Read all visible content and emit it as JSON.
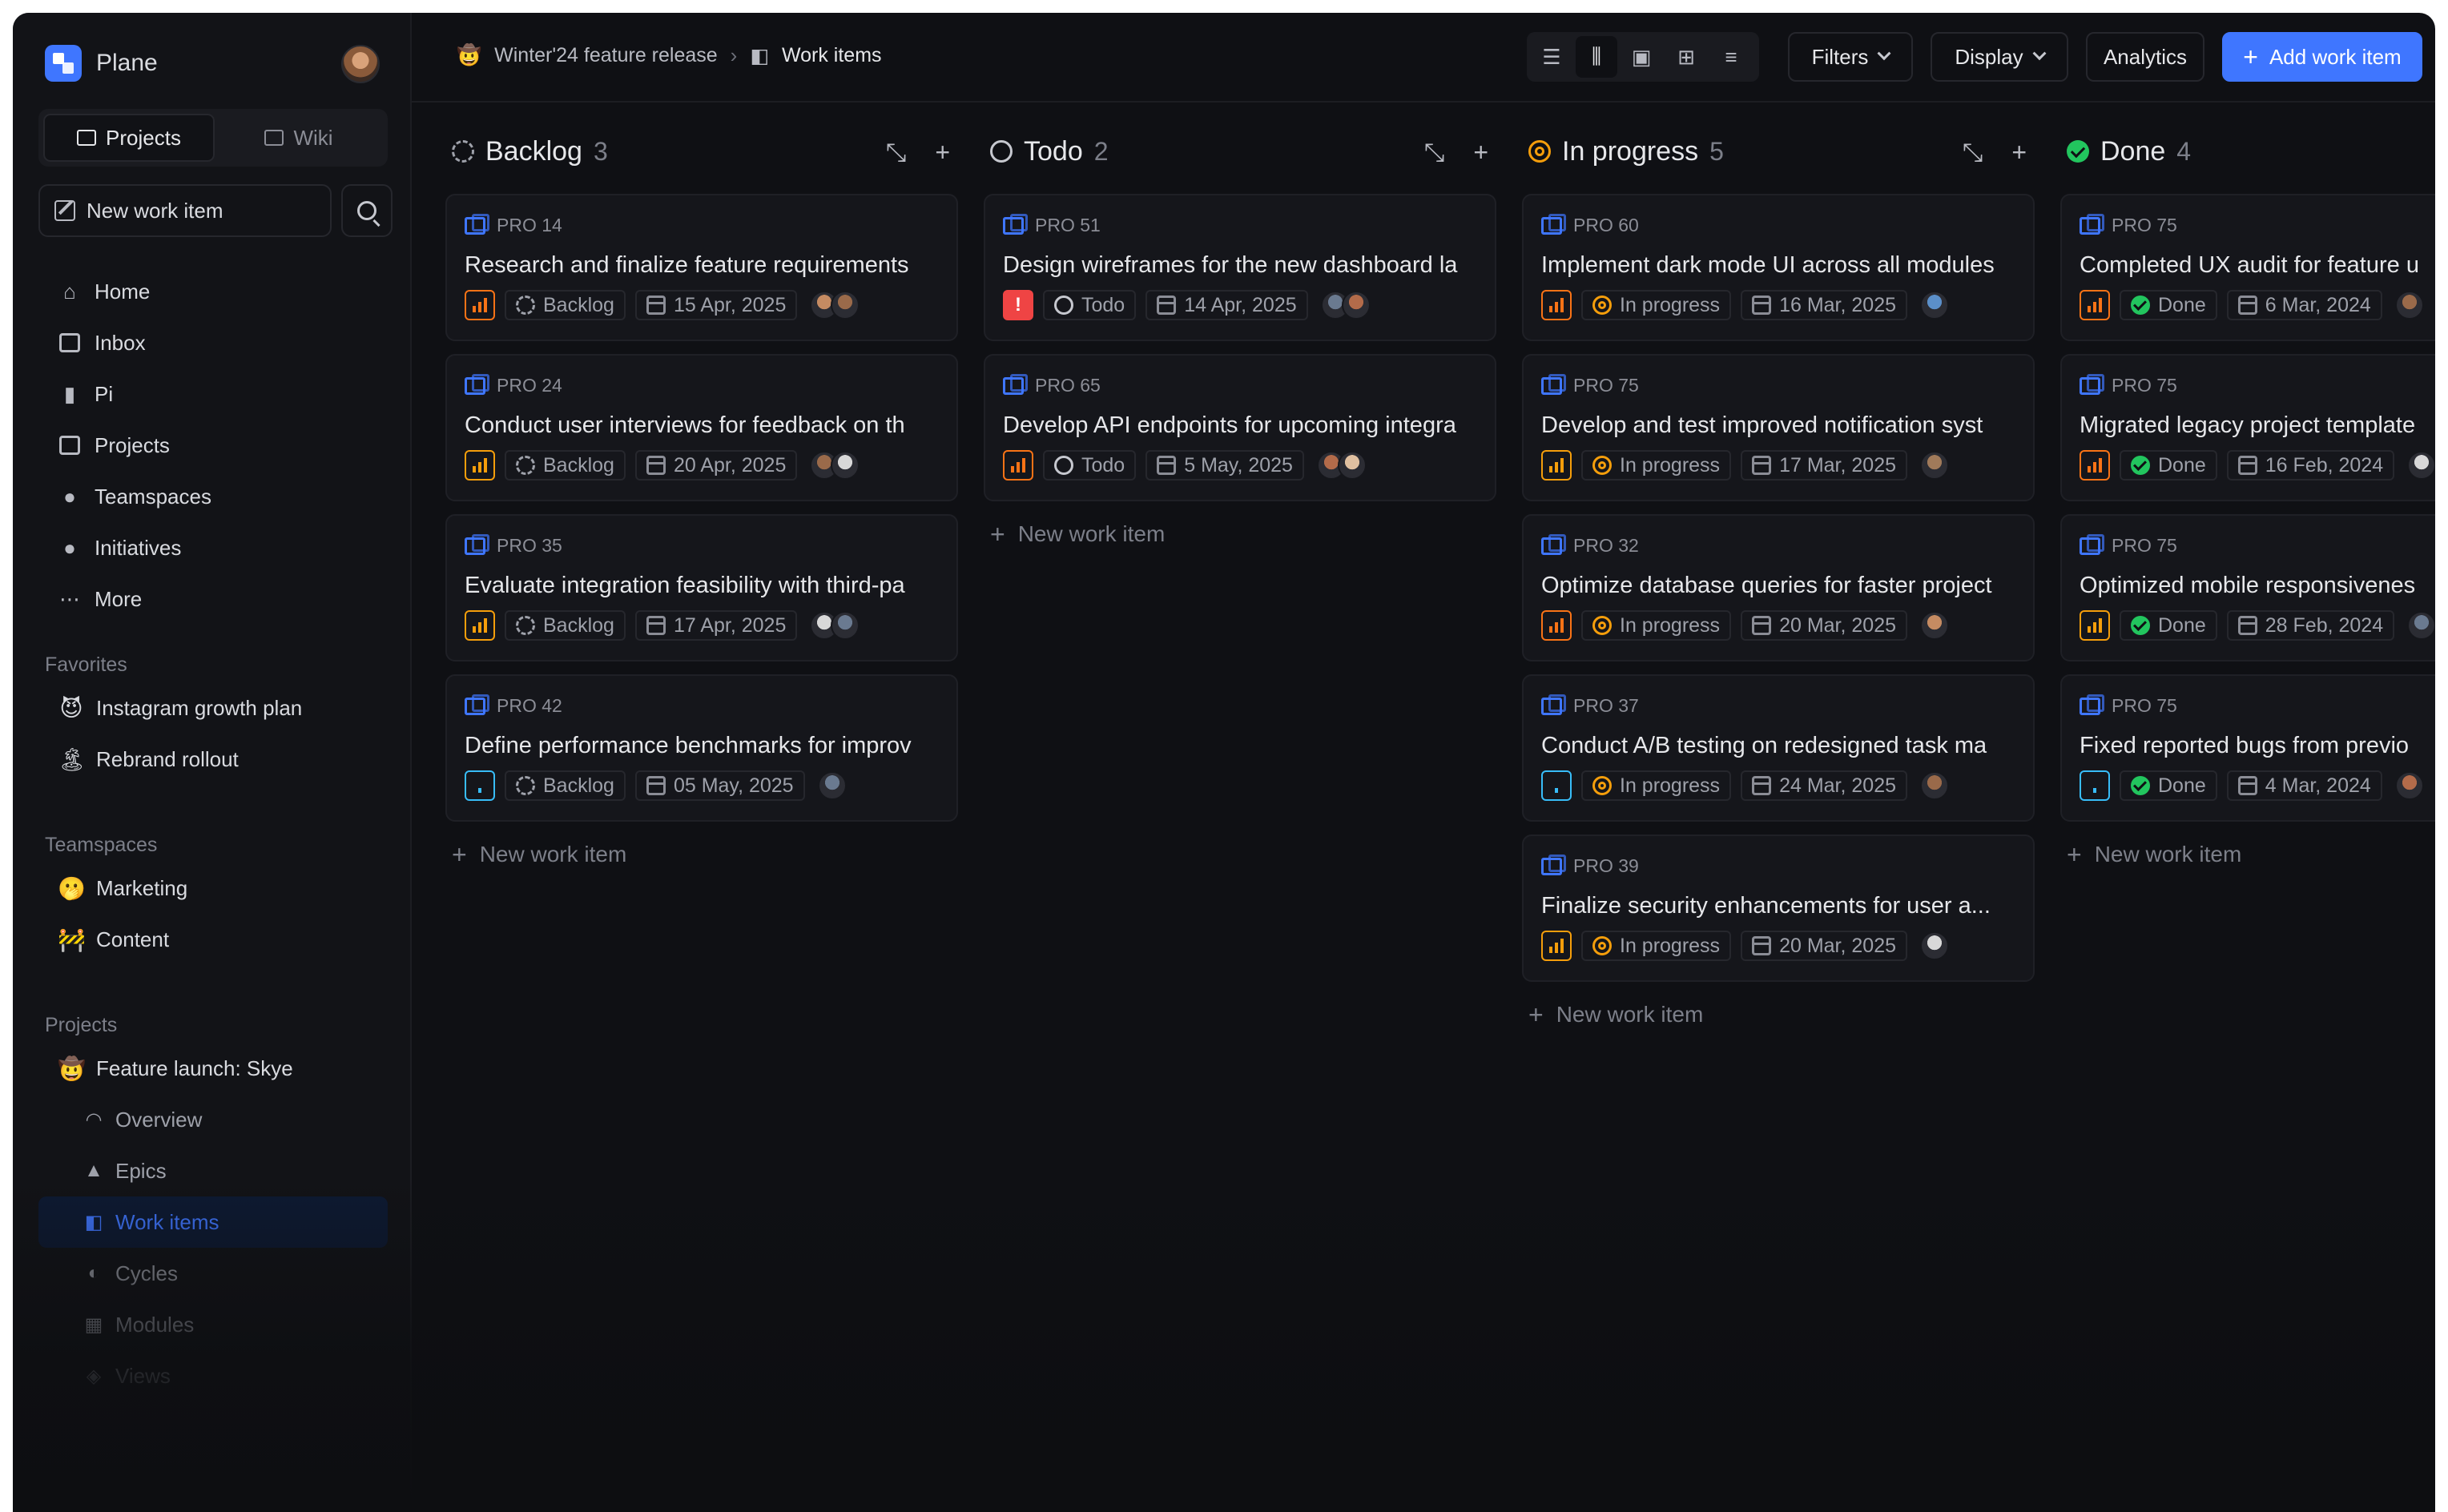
{
  "app": {
    "name": "Plane"
  },
  "sidebar": {
    "tabs": [
      {
        "label": "Projects"
      },
      {
        "label": "Wiki"
      }
    ],
    "new_work_item": "New work item",
    "nav": [
      {
        "label": "Home",
        "icon": "home-icon"
      },
      {
        "label": "Inbox",
        "icon": "inbox-icon"
      },
      {
        "label": "Pi",
        "icon": "pi-icon"
      },
      {
        "label": "Projects",
        "icon": "briefcase-icon"
      },
      {
        "label": "Teamspaces",
        "icon": "team-icon"
      },
      {
        "label": "Initiatives",
        "icon": "initiative-icon"
      },
      {
        "label": "More",
        "icon": "more-icon"
      }
    ],
    "favorites": {
      "heading": "Favorites",
      "items": [
        {
          "label": "Instagram growth plan",
          "emoji": "😈"
        },
        {
          "label": "Rebrand rollout",
          "emoji": "🏝"
        }
      ]
    },
    "teamspaces": {
      "heading": "Teamspaces",
      "items": [
        {
          "label": "Marketing",
          "emoji": "🫢"
        },
        {
          "label": "Content",
          "emoji": "🚧"
        }
      ]
    },
    "projects": {
      "heading": "Projects",
      "project": {
        "label": "Feature launch: Skye",
        "emoji": "🤠"
      },
      "subitems": [
        {
          "label": "Overview",
          "icon": "rss-icon"
        },
        {
          "label": "Epics",
          "icon": "epics-icon"
        },
        {
          "label": "Work items",
          "icon": "work-items-icon"
        },
        {
          "label": "Cycles",
          "icon": "cycles-icon"
        },
        {
          "label": "Modules",
          "icon": "modules-icon"
        },
        {
          "label": "Views",
          "icon": "views-icon"
        }
      ]
    }
  },
  "topbar": {
    "breadcrumb": [
      {
        "label": "Winter'24 feature release",
        "emoji": "🤠"
      },
      {
        "label": "Work items"
      }
    ],
    "filters": "Filters",
    "display": "Display",
    "analytics": "Analytics",
    "add": "Add work item"
  },
  "colors": {
    "accent": "#3f76ff",
    "urgent": "#ef4444",
    "high": "#f97316",
    "medium": "#f59e0b",
    "low": "#38bdf8",
    "done": "#22c55e"
  },
  "board": {
    "new_item": "New work item",
    "columns": [
      {
        "title": "Backlog",
        "count": "3",
        "status": "backlog",
        "cards": [
          {
            "id": "PRO 14",
            "title": "Research and finalize feature requirements",
            "priority": "high",
            "state": "Backlog",
            "date": "15 Apr, 2025"
          },
          {
            "id": "PRO 24",
            "title": "Conduct user interviews for feedback on th",
            "priority": "medium",
            "state": "Backlog",
            "date": "20 Apr, 2025"
          },
          {
            "id": "PRO 35",
            "title": "Evaluate integration feasibility with third-pa",
            "priority": "medium",
            "state": "Backlog",
            "date": "17 Apr, 2025"
          },
          {
            "id": "PRO 42",
            "title": "Define performance benchmarks for improv",
            "priority": "low",
            "state": "Backlog",
            "date": "05 May, 2025"
          }
        ]
      },
      {
        "title": "Todo",
        "count": "2",
        "status": "todo",
        "cards": [
          {
            "id": "PRO 51",
            "title": "Design wireframes for the new dashboard la",
            "priority": "urgent",
            "state": "Todo",
            "date": "14 Apr, 2025"
          },
          {
            "id": "PRO 65",
            "title": "Develop API endpoints for upcoming integra",
            "priority": "high",
            "state": "Todo",
            "date": "5 May, 2025"
          }
        ]
      },
      {
        "title": "In progress",
        "count": "5",
        "status": "prog",
        "cards": [
          {
            "id": "PRO 60",
            "title": "Implement dark mode UI across all modules",
            "priority": "high",
            "state": "In progress",
            "date": "16 Mar, 2025"
          },
          {
            "id": "PRO 75",
            "title": "Develop and test improved notification syst",
            "priority": "medium",
            "state": "In progress",
            "date": "17 Mar, 2025"
          },
          {
            "id": "PRO 32",
            "title": "Optimize database queries for faster project",
            "priority": "high",
            "state": "In progress",
            "date": "20 Mar, 2025"
          },
          {
            "id": "PRO 37",
            "title": "Conduct A/B testing on redesigned task ma",
            "priority": "low",
            "state": "In progress",
            "date": "24 Mar, 2025"
          },
          {
            "id": "PRO 39",
            "title": "Finalize security enhancements for user a...",
            "priority": "medium",
            "state": "In progress",
            "date": "20 Mar, 2025"
          }
        ]
      },
      {
        "title": "Done",
        "count": "4",
        "status": "done",
        "cards": [
          {
            "id": "PRO 75",
            "title": "Completed UX audit for feature u",
            "priority": "high",
            "state": "Done",
            "date": "6 Mar, 2024"
          },
          {
            "id": "PRO 75",
            "title": "Migrated legacy project template",
            "priority": "high",
            "state": "Done",
            "date": "16 Feb, 2024"
          },
          {
            "id": "PRO 75",
            "title": "Optimized mobile responsivenes",
            "priority": "medium",
            "state": "Done",
            "date": "28 Feb, 2024"
          },
          {
            "id": "PRO 75",
            "title": "Fixed reported bugs from previo",
            "priority": "low",
            "state": "Done",
            "date": "4 Mar, 2024"
          }
        ]
      }
    ]
  }
}
